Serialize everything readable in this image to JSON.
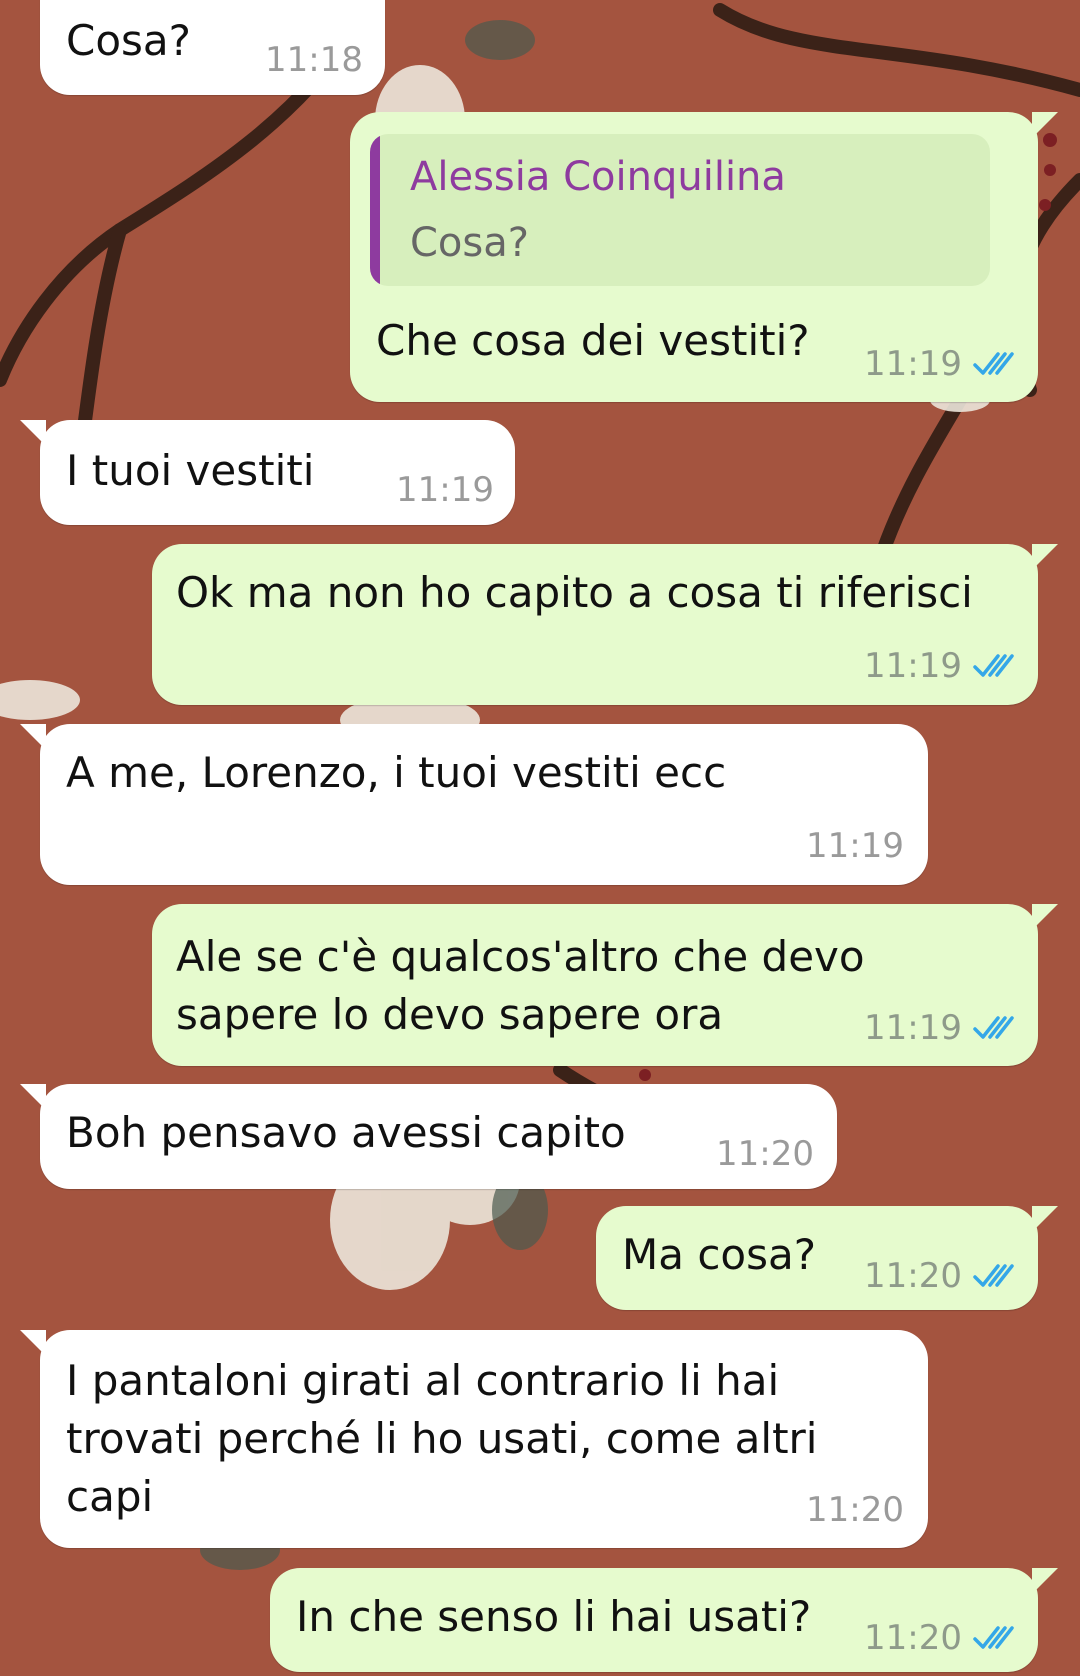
{
  "colors": {
    "wallpaper": "#a4543f",
    "incoming_bubble": "#ffffff",
    "outgoing_bubble": "#e6fbce",
    "quote_author": "#8e3b9f",
    "read_ticks": "#34a7e8"
  },
  "messages": [
    {
      "direction": "in",
      "text": "Cosa?",
      "time": "11:18"
    },
    {
      "direction": "out",
      "reply_to": {
        "author": "Alessia Coinquilina",
        "text": "Cosa?"
      },
      "text": "Che cosa dei vestiti?",
      "time": "11:19",
      "status_icon": "double-check-read-icon"
    },
    {
      "direction": "in",
      "text": "I tuoi vestiti",
      "time": "11:19"
    },
    {
      "direction": "out",
      "text": "Ok ma non ho capito a cosa ti riferisci",
      "time": "11:19",
      "status_icon": "double-check-read-icon"
    },
    {
      "direction": "in",
      "text": "A me, Lorenzo, i tuoi vestiti ecc",
      "time": "11:19"
    },
    {
      "direction": "out",
      "lines": [
        "Ale se c'è qualcos'altro che devo",
        "sapere lo devo sapere ora"
      ],
      "time": "11:19",
      "status_icon": "double-check-read-icon"
    },
    {
      "direction": "in",
      "text": "Boh pensavo avessi capito",
      "time": "11:20"
    },
    {
      "direction": "out",
      "text": "Ma cosa?",
      "time": "11:20",
      "status_icon": "double-check-read-icon"
    },
    {
      "direction": "in",
      "lines": [
        "I pantaloni girati al contrario li hai",
        "trovati perché li ho usati, come altri",
        "capi"
      ],
      "time": "11:20"
    },
    {
      "direction": "out",
      "text": "In che senso li hai usati?",
      "time": "11:20",
      "status_icon": "double-check-read-icon"
    }
  ]
}
